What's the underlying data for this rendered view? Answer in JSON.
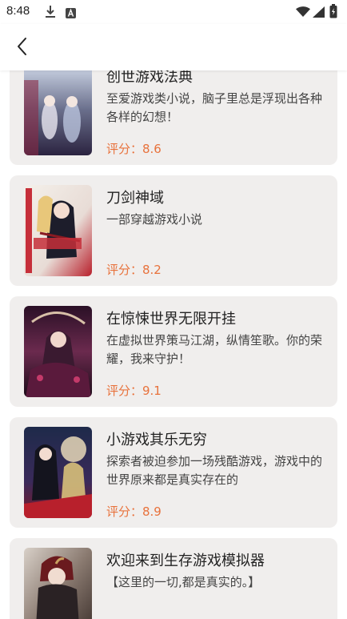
{
  "status_bar": {
    "time": "8:48",
    "icons": [
      "download-icon",
      "font-a-icon",
      "wifi-icon",
      "signal-icon",
      "battery-icon"
    ]
  },
  "app_bar": {
    "back_icon": "chevron-left-icon"
  },
  "books": [
    {
      "title": "创世游戏法典",
      "description": "至爱游戏类小说，脑子里总是浮现出各种各样的幻想！",
      "rating": "评分：8.6"
    },
    {
      "title": "刀剑神域",
      "description": "一部穿越游戏小说",
      "rating": "评分：8.2"
    },
    {
      "title": "在惊悚世界无限开挂",
      "description": "在虚拟世界策马江湖，纵情笙歌。你的荣耀，我来守护！",
      "rating": "评分：9.1"
    },
    {
      "title": "小游戏其乐无穷",
      "description": "探索者被迫参加一场残酷游戏，游戏中的世界原来都是真实存在的",
      "rating": "评分：8.9"
    },
    {
      "title": "欢迎来到生存游戏模拟器",
      "description": "【这里的一切,都是真实的。】",
      "rating": ""
    }
  ],
  "colors": {
    "accent": "#e8723c",
    "card_bg": "#f0eeed"
  }
}
